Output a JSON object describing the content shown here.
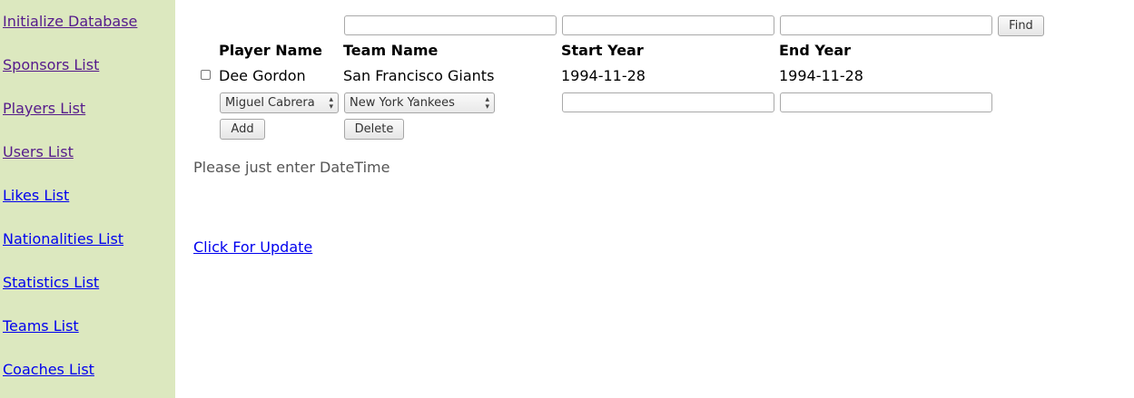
{
  "sidebar": {
    "items": [
      {
        "label": "Initialize Database"
      },
      {
        "label": "Sponsors List"
      },
      {
        "label": "Players List"
      },
      {
        "label": "Users List"
      },
      {
        "label": "Likes List"
      },
      {
        "label": "Nationalities List"
      },
      {
        "label": "Statistics List"
      },
      {
        "label": "Teams List"
      },
      {
        "label": "Coaches List"
      }
    ]
  },
  "search": {
    "field1_value": "",
    "field2_value": "",
    "field3_value": "",
    "find_label": "Find"
  },
  "table": {
    "headers": [
      "Player Name",
      "Team Name",
      "Start Year",
      "End Year"
    ],
    "rows": [
      {
        "player": "Dee Gordon",
        "team": "San Francisco Giants",
        "start": "1994-11-28",
        "end": "1994-11-28",
        "checked": false
      }
    ]
  },
  "new_row": {
    "player_selected": "Miguel Cabrera",
    "team_selected": "New York Yankees",
    "start_value": "",
    "end_value": "",
    "add_label": "Add",
    "delete_label": "Delete"
  },
  "message": "Please just enter DateTime",
  "update_link": "Click For Update"
}
